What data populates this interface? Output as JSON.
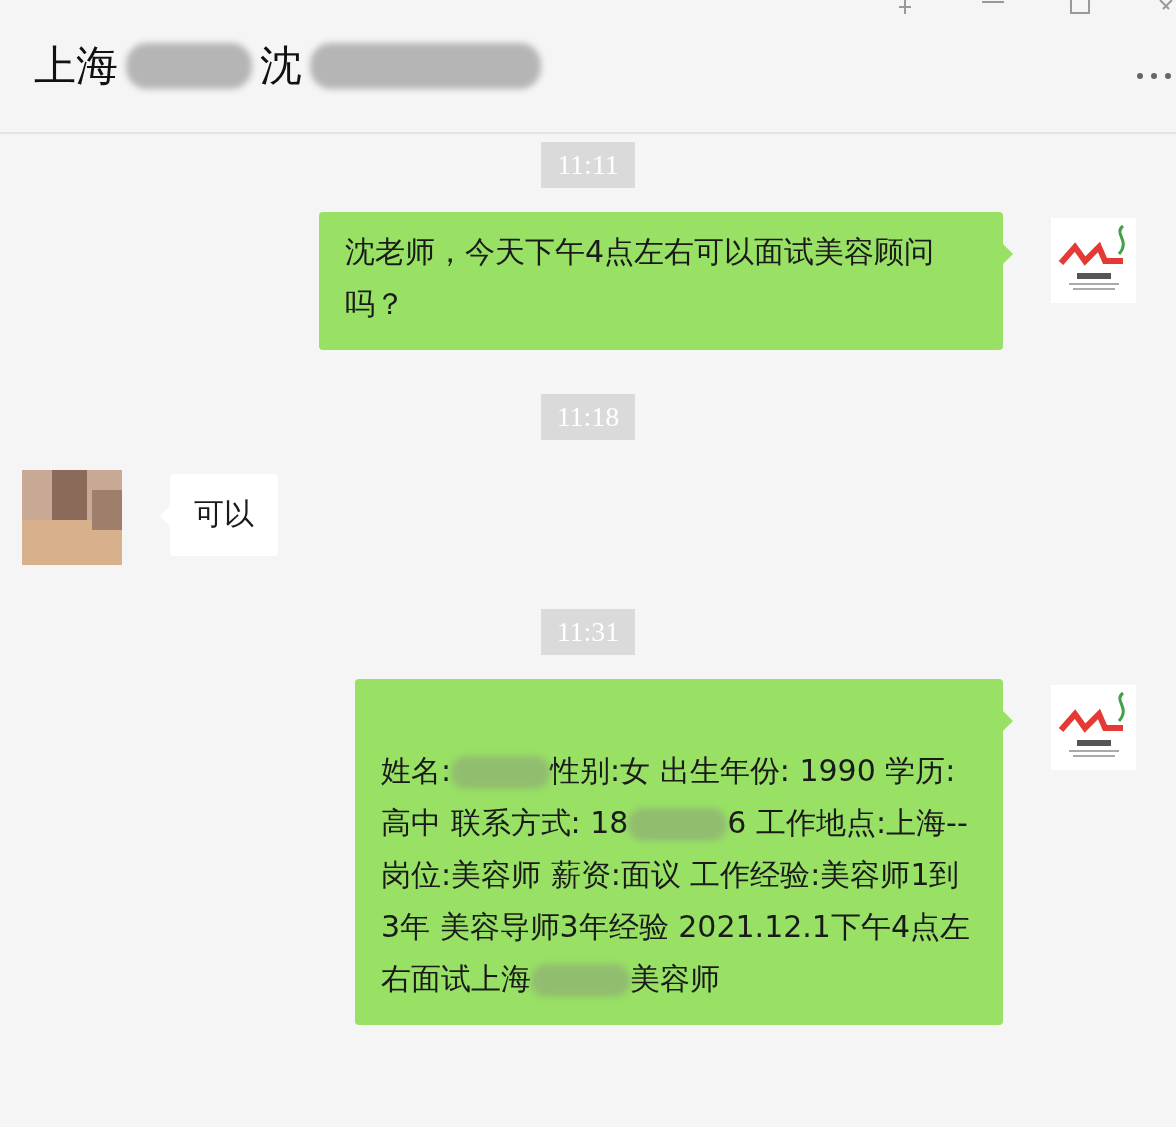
{
  "header": {
    "title": [
      {
        "kind": "text",
        "text": "上海"
      },
      {
        "kind": "blur"
      },
      {
        "kind": "text",
        "text": "沈"
      },
      {
        "kind": "blur"
      }
    ]
  },
  "messages": [
    {
      "kind": "time",
      "text": "11:11"
    },
    {
      "kind": "sent",
      "segments": [
        {
          "kind": "text",
          "text": "沈老师，今天下午4点左右可以面试美容顾问吗？"
        }
      ]
    },
    {
      "kind": "time",
      "text": "11:18"
    },
    {
      "kind": "received",
      "segments": [
        {
          "kind": "text",
          "text": "可以"
        }
      ]
    },
    {
      "kind": "time",
      "text": "11:31"
    },
    {
      "kind": "sent",
      "segments": [
        {
          "kind": "text",
          "text": "\n姓名:"
        },
        {
          "kind": "blur"
        },
        {
          "kind": "text",
          "text": "性别:女 出生年份: 1990 学历:高中 联系方式: 18"
        },
        {
          "kind": "blur"
        },
        {
          "kind": "text",
          "text": "6 工作地点:上海-- 岗位:美容师 薪资:面议 工作经验:美容师1到3年 美容导师3年经验 2021.12.1下午4点左右面试上海"
        },
        {
          "kind": "blur"
        },
        {
          "kind": "text",
          "text": "美容师"
        }
      ]
    }
  ]
}
